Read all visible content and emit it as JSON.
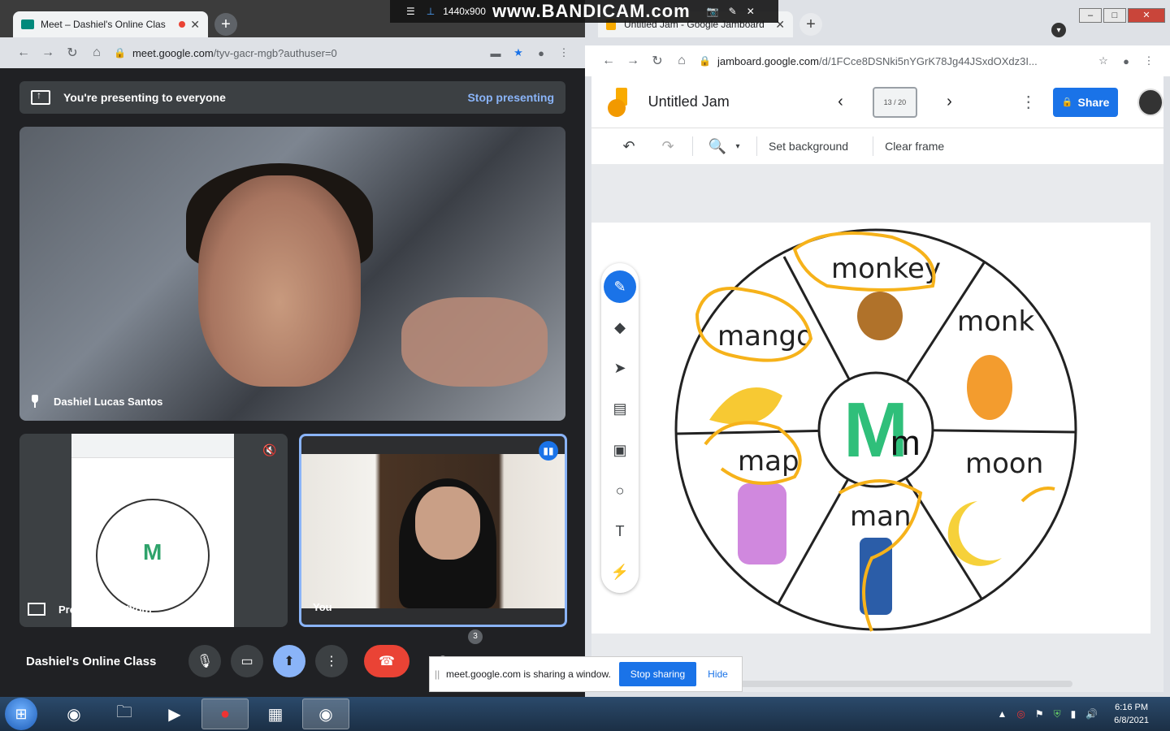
{
  "recorder": {
    "resolution": "1440x900",
    "brand": "www.BANDICAM.com"
  },
  "meet": {
    "tab_title": "Meet – Dashiel's Online Clas",
    "url_host": "meet.google.com",
    "url_path": "/tyv-gacr-mgb?authuser=0",
    "presenting_text": "You're presenting to everyone",
    "stop_presenting": "Stop presenting",
    "main_participant": "Dashiel Lucas Santos",
    "presentation_label": "Presentation (You)",
    "you_label": "You",
    "meeting_title": "Dashiel's Online Class",
    "people_count": "3"
  },
  "jam": {
    "tab_title": "Untitled Jam - Google Jamboard",
    "url_host": "jamboard.google.com",
    "url_path": "/d/1FCce8DSNki5nYGrK78Jg44JSxdOXdz3I...",
    "title": "Untitled Jam",
    "frame_counter": "13 / 20",
    "share": "Share",
    "set_background": "Set background",
    "clear_frame": "Clear frame",
    "wheel": {
      "center_big": "M",
      "center_small": "m",
      "words": [
        "monkey",
        "monk",
        "moon",
        "man",
        "map",
        "mango"
      ]
    }
  },
  "sharing_notice": {
    "text": "meet.google.com is sharing a window.",
    "stop": "Stop sharing",
    "hide": "Hide"
  },
  "clock": {
    "time": "6:16 PM",
    "date": "6/8/2021"
  }
}
